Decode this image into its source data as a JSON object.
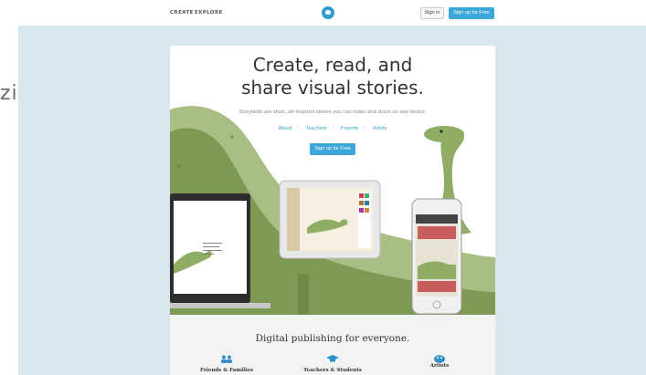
{
  "side_fragment": "zi",
  "nav": {
    "create": "CREATE",
    "explore": "EXPLORE",
    "sign_in": "Sign in",
    "sign_up": "Sign up for Free",
    "logo_icon": "storybird-logo-icon"
  },
  "hero": {
    "headline_line1": "Create, read, and",
    "headline_line2": "share visual stories.",
    "tagline": "Storybirds are short, art-inspired stories you can make and share on any device.",
    "links": [
      "About",
      "Teachers",
      "Parents",
      "Artists"
    ],
    "cta": "Sign up for Free"
  },
  "bottom": {
    "title": "Digital publishing for everyone.",
    "features": [
      {
        "label": "Friends & Families",
        "icon": "people-icon"
      },
      {
        "label": "Teachers & Students",
        "icon": "graduation-cap-icon"
      },
      {
        "label": "Artists",
        "icon": "palette-icon"
      }
    ]
  },
  "colors": {
    "accent": "#3aa7d8",
    "background": "#d7e7ee",
    "dino_dark": "#7d9a55",
    "dino_light": "#a8be82"
  }
}
